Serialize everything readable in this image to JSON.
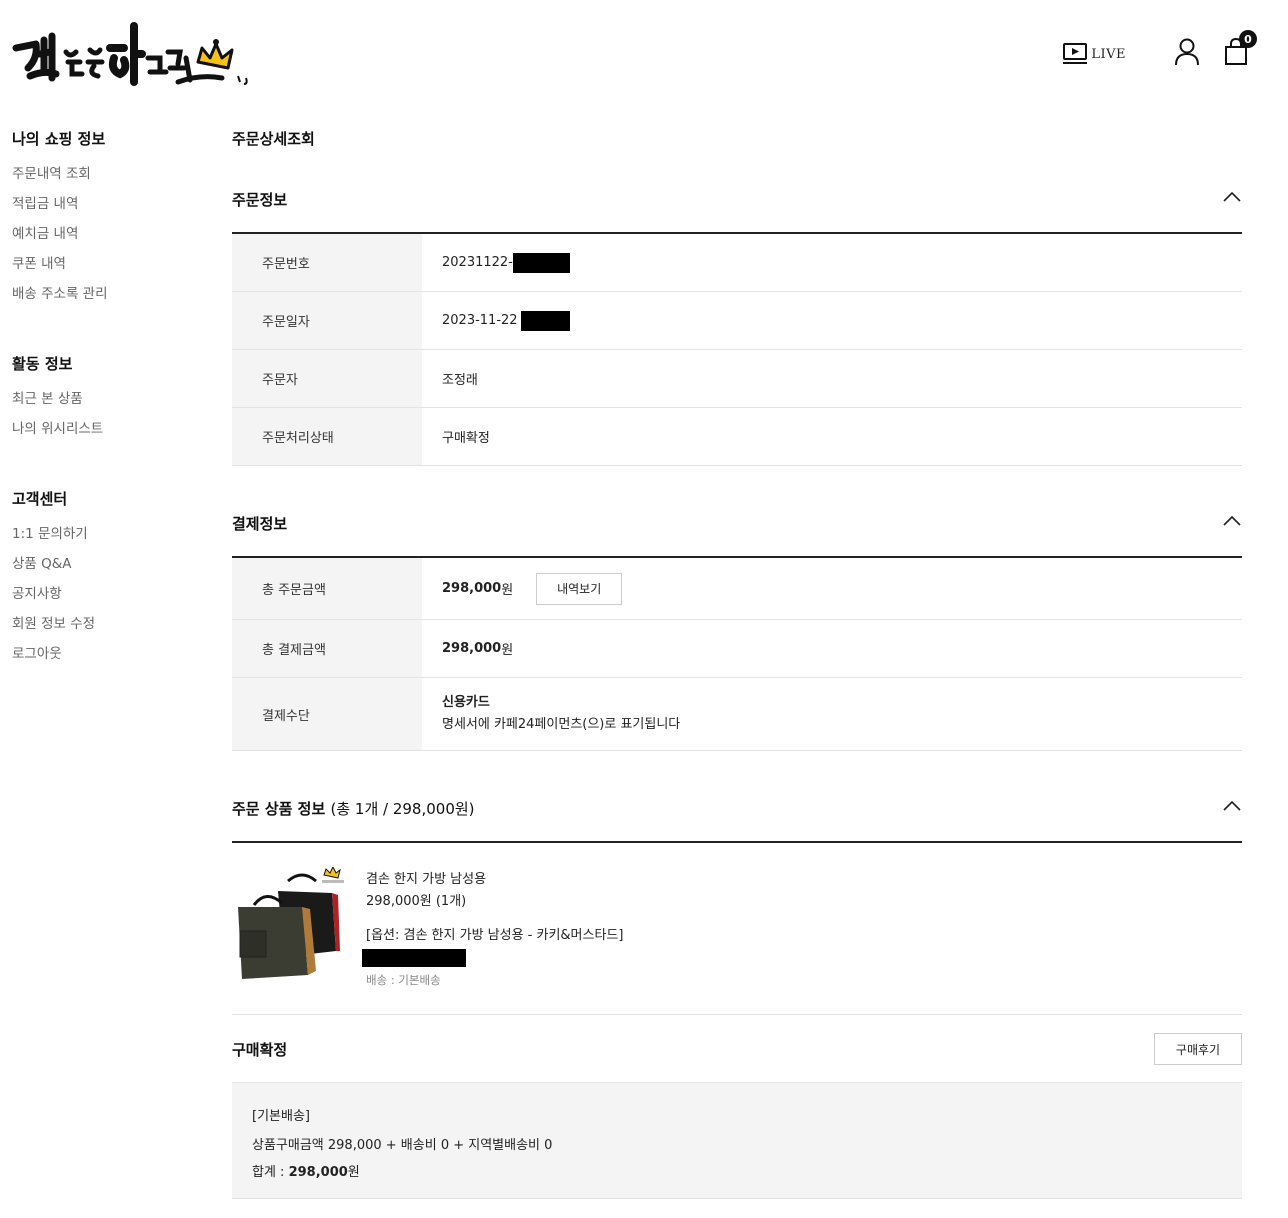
{
  "header": {
    "logo_text": "겸손은힘들다",
    "live_label": "LIVE",
    "cart_count": "0"
  },
  "sidebar": {
    "groups": [
      {
        "title": "나의 쇼핑 정보",
        "items": [
          "주문내역 조회",
          "적립금 내역",
          "예치금 내역",
          "쿠폰 내역",
          "배송 주소록 관리"
        ]
      },
      {
        "title": "활동 정보",
        "items": [
          "최근 본 상품",
          "나의 위시리스트"
        ]
      },
      {
        "title": "고객센터",
        "items": [
          "1:1 문의하기",
          "상품 Q&A",
          "공지사항",
          "회원 정보 수정",
          "로그아웃"
        ]
      }
    ]
  },
  "page_title": "주문상세조회",
  "order_info": {
    "title": "주문정보",
    "rows": [
      {
        "label": "주문번호",
        "value": "20231122-"
      },
      {
        "label": "주문일자",
        "value": "2023-11-22"
      },
      {
        "label": "주문자",
        "value": "조정래"
      },
      {
        "label": "주문처리상태",
        "value": "구매확정"
      }
    ]
  },
  "payment_info": {
    "title": "결제정보",
    "total_order_label": "총 주문금액",
    "total_order_amount": "298,000",
    "won": "원",
    "detail_button": "내역보기",
    "total_paid_label": "총 결제금액",
    "total_paid_amount": "298,000",
    "method_label": "결제수단",
    "method_value": "신용카드",
    "method_note": "명세서에 카페24페이먼츠(으)로 표기됩니다"
  },
  "product_info": {
    "title": "주문 상품 정보",
    "summary": "(총 1개 / 298,000원)",
    "name": "겸손 한지 가방 남성용",
    "price": "298,000원 (1개)",
    "option": "[옵션: 겸손 한지 가방 남성용 - 카키&머스타드]",
    "delivery": "배송 : 기본배송"
  },
  "confirm": {
    "title": "구매확정",
    "review_button": "구매후기",
    "delivery_type": "[기본배송]",
    "breakdown": "상품구매금액 298,000 + 배송비 0 + 지역별배송비 0",
    "total_label": "합계 : ",
    "total_value": "298,000",
    "total_unit": "원"
  }
}
